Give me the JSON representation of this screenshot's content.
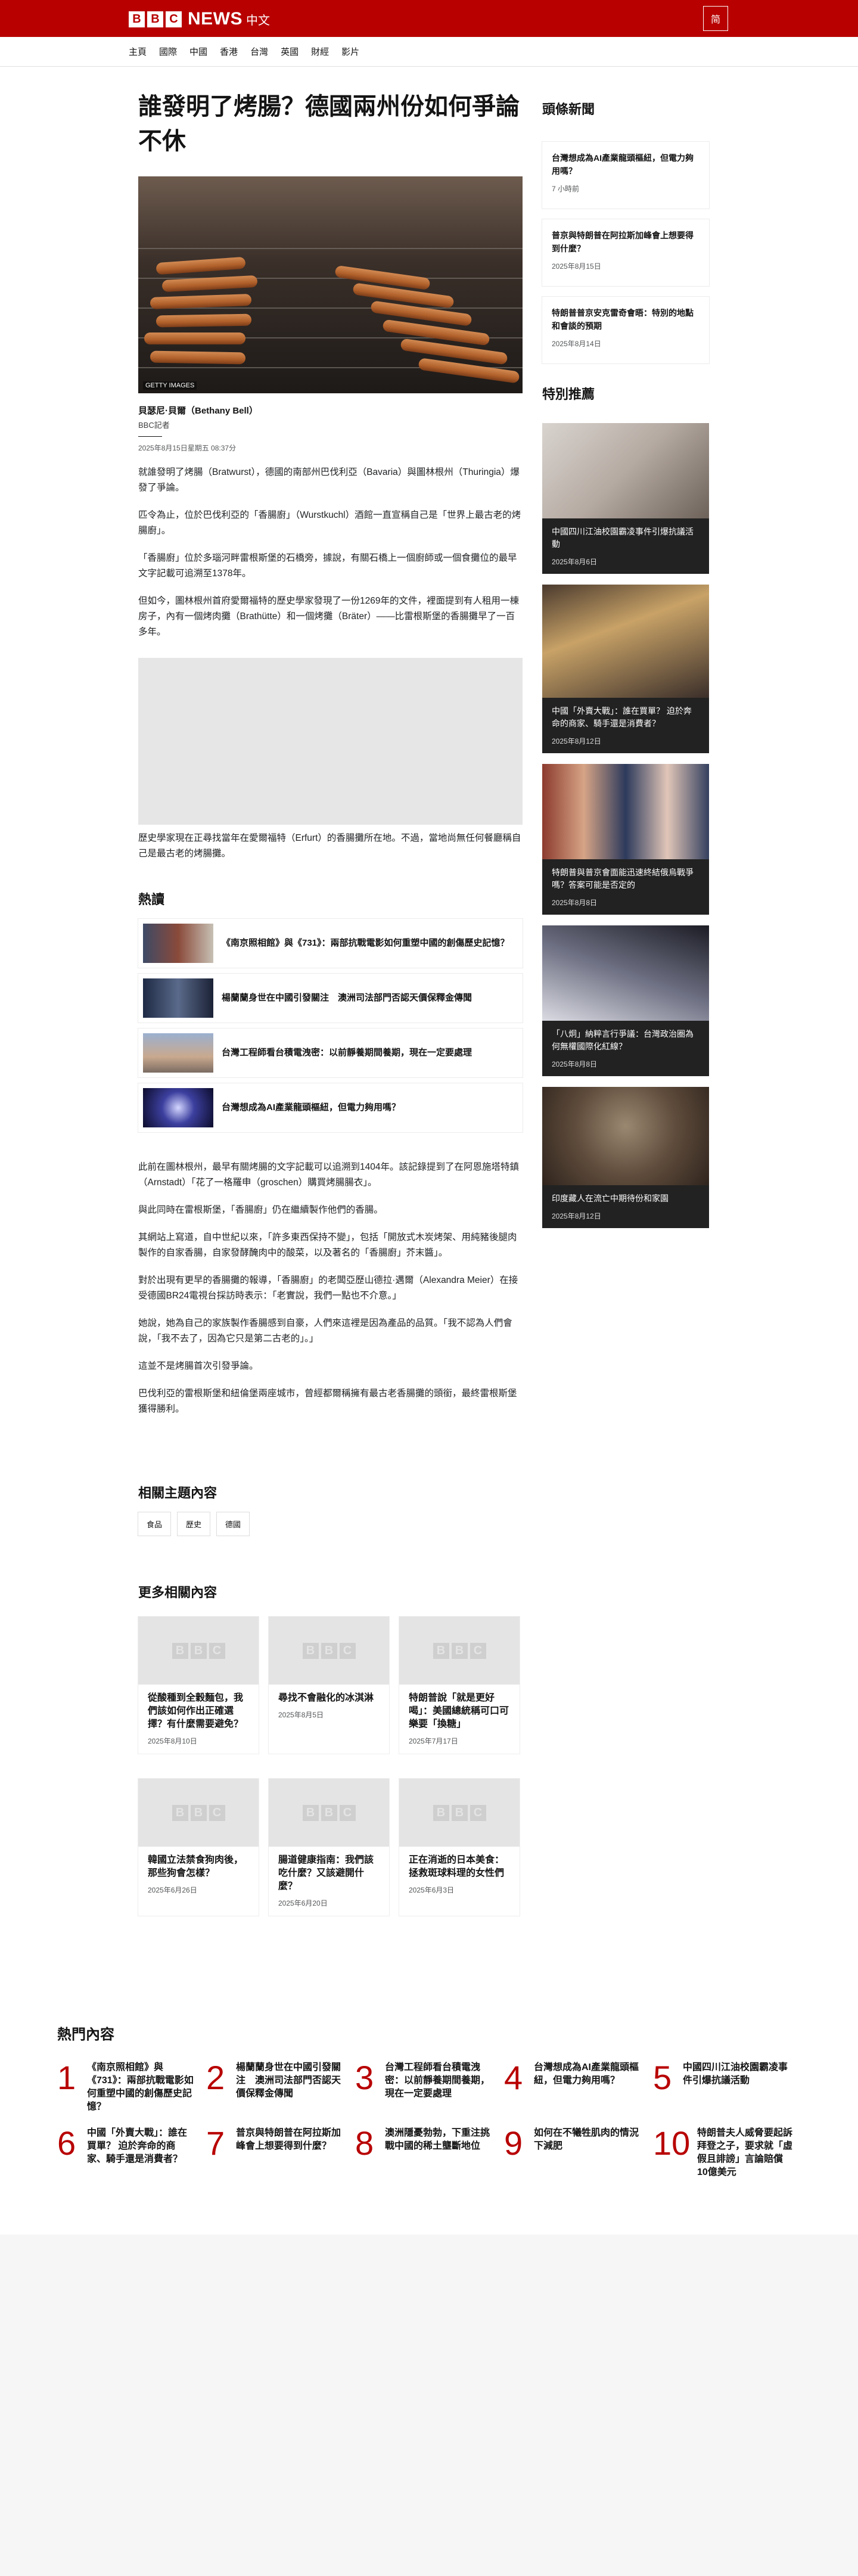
{
  "header": {
    "logo_letters": [
      "B",
      "B",
      "C"
    ],
    "brand": "NEWS",
    "brand_sub": "中文",
    "lang_button": "简"
  },
  "nav": [
    "主頁",
    "國際",
    "中國",
    "香港",
    "台灣",
    "英國",
    "財經",
    "影片"
  ],
  "article": {
    "title": "誰發明了烤腸？德國兩州份如何爭論不休",
    "image_credit": "GETTY IMAGES",
    "author": "貝瑟尼·貝爾（Bethany Bell）",
    "role": "BBC記者",
    "date": "2025年8月15日星期五 08:37分",
    "paragraphs": [
      "就誰發明了烤腸（Bratwurst），德國的南部州巴伐利亞（Bavaria）與圖林根州（Thuringia）爆發了爭論。",
      "匹令為止，位於巴伐利亞的「香腸廚」（Wurstkuchl）酒館一直宣稱自己是「世界上最古老的烤腸廚」。",
      "「香腸廚」位於多瑙河畔雷根斯堡的石橋旁，據說，有關石橋上一個廚師或一個食攤位的最早文字記載可追溯至1378年。",
      "但如今，圖林根州首府愛爾福特的歷史學家發現了一份1269年的文件，裡面提到有人租用一棟房子，內有一個烤肉攤（Brathütte）和一個烤攤（Bräter）——比雷根斯堡的香腸攤早了一百多年。"
    ],
    "paragraph_after_ad": "歷史學家現在正尋找當年在愛爾福特（Erfurt）的香腸攤所在地。不過，當地尚無任何餐廳稱自己是最古老的烤腸攤。",
    "paragraphs_2": [
      "此前在圖林根州，最早有關烤腸的文字記載可以追溯到1404年。該記錄提到了在阿恩施塔特鎮（Arnstadt）「花了一格羅申（groschen）購買烤腸腸衣」。",
      "與此同時在雷根斯堡，「香腸廚」仍在繼續製作他們的香腸。",
      "其網站上寫道，自中世紀以來，「許多東西保持不變」，包括「開放式木炭烤架、用純豬後腿肉製作的自家香腸，自家發酵醃肉中的酸菜，以及著名的「香腸廚」芥末醬」。",
      "對於出現有更早的香腸攤的報導，「香腸廚」的老闆亞歷山德拉·邁爾（Alexandra Meier）在接受德國BR24電視台採訪時表示：「老實說，我們一點也不介意。」",
      "她說，她為自己的家族製作香腸感到自豪，人們來這裡是因為產品的品質。「我不認為人們會說，「我不去了，因為它只是第二古老的」。」",
      "這並不是烤腸首次引發爭論。",
      "巴伐利亞的雷根斯堡和紐倫堡兩座城市，曾經都爾稱擁有最古老香腸攤的頭銜，最終雷根斯堡獲得勝利。"
    ]
  },
  "hot_reads": {
    "title": "熱讀",
    "items": [
      "《南京照相館》與《731》：兩部抗戰電影如何重塑中國的創傷歷史記憶？",
      "楊蘭蘭身世在中國引發關注　澳洲司法部門否認天價保釋金傳聞",
      "台灣工程師看台積電洩密：以前靜養期間養期，現在一定要處理",
      "台灣想成為AI產業龍頭樞紐，但電力夠用嗎？"
    ]
  },
  "tags": {
    "title": "相關主題內容",
    "items": [
      "食品",
      "歷史",
      "德國"
    ]
  },
  "more": {
    "title": "更多相關內容",
    "cards": [
      {
        "title": "從酸種到全穀麵包，我們該如何作出正確選擇？有什麼需要避免？",
        "date": "2025年8月10日"
      },
      {
        "title": "尋找不會融化的冰淇淋",
        "date": "2025年8月5日"
      },
      {
        "title": "特朗普說「就是更好喝」：美國總統稱可口可樂要「換糖」",
        "date": "2025年7月17日"
      },
      {
        "title": "韓國立法禁食狗肉後，那些狗會怎樣？",
        "date": "2025年6月26日"
      },
      {
        "title": "腸道健康指南：我們該吃什麼？又該避開什麼？",
        "date": "2025年6月20日"
      },
      {
        "title": "正在消逝的日本美食：拯救斑球料理的女性們",
        "date": "2025年6月3日"
      }
    ]
  },
  "sidebar": {
    "top_title": "頭條新聞",
    "top_news": [
      {
        "title": "台灣想成為AI產業龍頭樞紐，但電力夠用嗎？",
        "date": "7 小時前"
      },
      {
        "title": "普京與特朗普在阿拉斯加峰會上想要得到什麼？",
        "date": "2025年8月15日"
      },
      {
        "title": "特朗普普京安克雷奇會晤：特別的地點和會談的預期",
        "date": "2025年8月14日"
      }
    ],
    "rec_title": "特別推薦",
    "rec": [
      {
        "title": "中國四川江油校園霸凌事件引爆抗議活動",
        "date": "2025年8月6日"
      },
      {
        "title": "中國「外賣大戰」：誰在買單？ 迫於奔命的商家、騎手還是消費者？",
        "date": "2025年8月12日"
      },
      {
        "title": "特朗普與普京會面能迅速終結俄烏戰爭嗎？答案可能是否定的",
        "date": "2025年8月8日"
      },
      {
        "title": "「八炯」納粹言行爭議：台灣政治圈為何無權國際化紅線？",
        "date": "2025年8月8日"
      },
      {
        "title": "印度藏人在流亡中期待份和家園",
        "date": "2025年8月12日"
      }
    ]
  },
  "popular": {
    "title": "熱門內容",
    "items": [
      {
        "n": "1",
        "title": "《南京照相館》與《731》：兩部抗戰電影如何重塑中國的創傷歷史記憶？"
      },
      {
        "n": "2",
        "title": "楊蘭蘭身世在中國引發關注　澳洲司法部門否認天價保釋金傳聞"
      },
      {
        "n": "3",
        "title": "台灣工程師看台積電洩密：以前靜養期間養期，現在一定要處理"
      },
      {
        "n": "4",
        "title": "台灣想成為AI產業龍頭樞紐，但電力夠用嗎？"
      },
      {
        "n": "5",
        "title": "中國四川江油校園霸凌事件引爆抗議活動"
      },
      {
        "n": "6",
        "title": "中國「外賣大戰」：誰在買單？ 迫於奔命的商家、騎手還是消費者？"
      },
      {
        "n": "7",
        "title": "普京與特朗普在阿拉斯加峰會上想要得到什麼？"
      },
      {
        "n": "8",
        "title": "澳洲隱憂勃勃，下重注挑戰中國的稀土壟斷地位"
      },
      {
        "n": "9",
        "title": "如何在不犧牲肌肉的情況下減肥"
      },
      {
        "n": "10",
        "title": "特朗普夫人威脅要起訴拜登之子，要求就「虛假且誹謗」言論賠償10億美元"
      }
    ]
  },
  "colors": {
    "brand_red": "#b80000",
    "text": "#141414"
  }
}
